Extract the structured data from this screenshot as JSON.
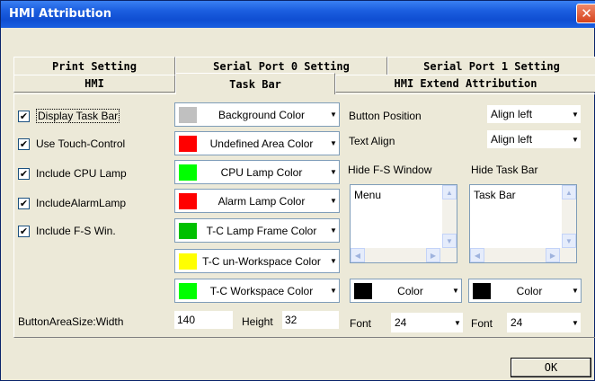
{
  "window": {
    "title": "HMI Attribution",
    "close_glyph": "✕"
  },
  "tabs_row1": [
    "Print Setting",
    "Serial Port 0 Setting",
    "Serial Port 1 Setting"
  ],
  "tabs_row2": [
    "HMI",
    "Task Bar",
    "HMI Extend Attribution"
  ],
  "active_tab": "Task Bar",
  "checkboxes": [
    {
      "label": "Display Task Bar",
      "checked": true
    },
    {
      "label": "Use Touch-Control",
      "checked": true
    },
    {
      "label": "Include CPU Lamp",
      "checked": true
    },
    {
      "label": "IncludeAlarmLamp",
      "checked": true
    },
    {
      "label": "Include F-S Win.",
      "checked": true
    }
  ],
  "check_glyph": "✔",
  "color_selectors": [
    {
      "label": "Background Color",
      "color": "#c0c0c0"
    },
    {
      "label": "Undefined Area Color",
      "color": "#ff0000"
    },
    {
      "label": "CPU Lamp Color",
      "color": "#00ff00"
    },
    {
      "label": "Alarm Lamp Color",
      "color": "#ff0000"
    },
    {
      "label": "T-C Lamp Frame Color",
      "color": "#00c000"
    },
    {
      "label": "T-C un-Workspace Color",
      "color": "#ffff00"
    },
    {
      "label": "T-C Workspace Color",
      "color": "#00ff00"
    }
  ],
  "dropdown_arrow": "▼",
  "right_panel": {
    "button_position_label": "Button Position",
    "button_position_value": "Align left",
    "text_align_label": "Text Align",
    "text_align_value": "Align left",
    "hide_fs_label": "Hide F-S Window",
    "hide_taskbar_label": "Hide Task Bar",
    "hide_fs_list": "Menu",
    "hide_taskbar_list": "Task Bar",
    "color_left_label": "Color",
    "color_right_label": "Color",
    "font_left_label": "Font",
    "font_left_value": "24",
    "font_right_label": "Font",
    "font_right_value": "24"
  },
  "bottom": {
    "width_label": "ButtonAreaSize:Width",
    "width_value": "140",
    "height_label": "Height",
    "height_value": "32"
  },
  "ok_label": "OK",
  "scroll_glyphs": {
    "up": "▲",
    "down": "▼",
    "left": "◀",
    "right": "▶"
  }
}
